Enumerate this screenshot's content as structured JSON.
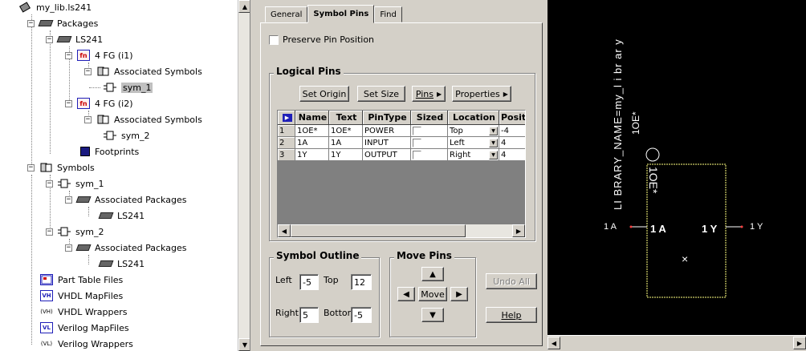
{
  "tree": {
    "root": "my_lib.ls241",
    "packages_label": "Packages",
    "package_name": "LS241",
    "fg1": "4 FG (i1)",
    "assoc_symbols_1": "Associated Symbols",
    "sym_1_leaf": "sym_1",
    "fg2": "4 FG (i2)",
    "assoc_symbols_2": "Associated Symbols",
    "sym_2_leaf": "sym_2",
    "footprints": "Footprints",
    "symbols_label": "Symbols",
    "sym_1": "sym_1",
    "assoc_packages_1": "Associated Packages",
    "ls241_a": "LS241",
    "sym_2": "sym_2",
    "assoc_packages_2": "Associated Packages",
    "ls241_b": "LS241",
    "part_table_files": "Part Table Files",
    "vhdl_mapfiles": "VHDL MapFiles",
    "vhdl_wrappers": "VHDL Wrappers",
    "verilog_mapfiles": "Verilog MapFiles",
    "verilog_wrappers": "Verilog Wrappers",
    "icon_vh": "VH",
    "icon_vhw": "(VH)",
    "icon_vl": "VL",
    "icon_vlw": "(VL)",
    "icon_fn": "fn"
  },
  "tabs": [
    "General",
    "Symbol Pins",
    "Find"
  ],
  "preserve_pin_position": "Preserve Pin Position",
  "logical_pins": {
    "title": "Logical Pins",
    "buttons": {
      "set_origin": "Set Origin",
      "set_size": "Set Size",
      "pins": "Pins",
      "properties": "Properties"
    },
    "columns": [
      "Name",
      "Text",
      "PinType",
      "Sized",
      "Location",
      "Positi"
    ],
    "rows": [
      {
        "num": "1",
        "name": "1OE*",
        "text": "1OE*",
        "pintype": "POWER",
        "location": "Top",
        "position": "-4"
      },
      {
        "num": "2",
        "name": "1A",
        "text": "1A",
        "pintype": "INPUT",
        "location": "Left",
        "position": "4"
      },
      {
        "num": "3",
        "name": "1Y",
        "text": "1Y",
        "pintype": "OUTPUT",
        "location": "Right",
        "position": "4"
      }
    ]
  },
  "symbol_outline": {
    "title": "Symbol Outline",
    "left_label": "Left",
    "left_value": "-5",
    "top_label": "Top",
    "top_value": "12",
    "right_label": "Right",
    "right_value": "5",
    "bottom_label": "Bottom",
    "bottom_value": "-5"
  },
  "move_pins": {
    "title": "Move Pins",
    "move_label": "Move"
  },
  "undo_all": "Undo All",
  "help": "Help",
  "canvas": {
    "library_name": "LI BRARY_NAME=my_l i br ar y",
    "pin_top_outer": "1OE*",
    "pin_top_inner": "1OE*",
    "pin_left_outer": "1 A",
    "pin_left_inner": "1 A",
    "pin_right_inner": "1 Y",
    "pin_right_outer": "1 Y",
    "origin_mark": "×"
  },
  "colors": {
    "canvas_bg": "#000000",
    "outline": "#ffff80",
    "pin_dot": "#ff4040"
  }
}
